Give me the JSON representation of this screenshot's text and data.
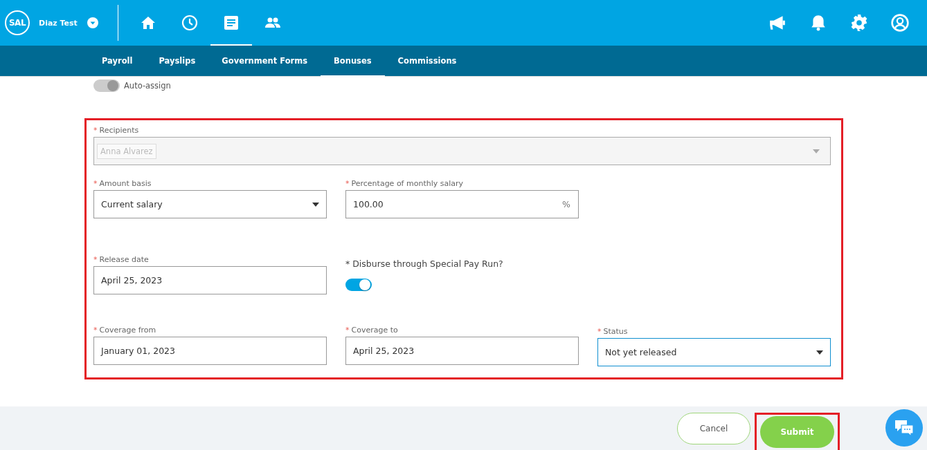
{
  "header": {
    "logo": "SAL",
    "company": "Diaz Test",
    "nav": [
      {
        "kind": "home",
        "selected": false
      },
      {
        "kind": "clock",
        "selected": false
      },
      {
        "kind": "document",
        "selected": true
      },
      {
        "kind": "people",
        "selected": false
      }
    ],
    "actions": [
      {
        "kind": "megaphone"
      },
      {
        "kind": "bell"
      },
      {
        "kind": "settings"
      },
      {
        "kind": "account"
      }
    ]
  },
  "tabs": [
    {
      "label": "Payroll",
      "selected": false
    },
    {
      "label": "Payslips",
      "selected": false
    },
    {
      "label": "Government Forms",
      "selected": false
    },
    {
      "label": "Bonuses",
      "selected": true
    },
    {
      "label": "Commissions",
      "selected": false
    }
  ],
  "auto_assign": {
    "label": "Auto-assign",
    "on": true,
    "disabled": true
  },
  "form": {
    "rows": [
      [
        {
          "kind": "tags",
          "marker": "*",
          "label": "Recipients",
          "disabled": true,
          "tags": [
            "Anna Alvarez"
          ]
        }
      ],
      [
        {
          "kind": "select",
          "marker": "*",
          "label": "Amount basis",
          "value": "Current salary"
        },
        {
          "kind": "input",
          "marker": "*",
          "label": "Percentage of monthly salary",
          "value": "100.00",
          "suffix": "%"
        }
      ],
      [
        {
          "kind": "input",
          "marker": "*",
          "label": "Release date",
          "value": "April 25, 2023"
        },
        {
          "kind": "toggle",
          "label": "* Disburse through Special Pay Run?",
          "on": true
        }
      ],
      [
        {
          "kind": "input",
          "marker": "*",
          "label": "Coverage from",
          "value": "January 01, 2023"
        },
        {
          "kind": "input",
          "marker": "*",
          "label": "Coverage to",
          "value": "April 25, 2023"
        },
        {
          "kind": "select",
          "marker": "*",
          "label": "Status",
          "value": "Not yet released",
          "focused": true
        }
      ]
    ]
  },
  "footer": {
    "cancel": "Cancel",
    "submit": "Submit"
  }
}
